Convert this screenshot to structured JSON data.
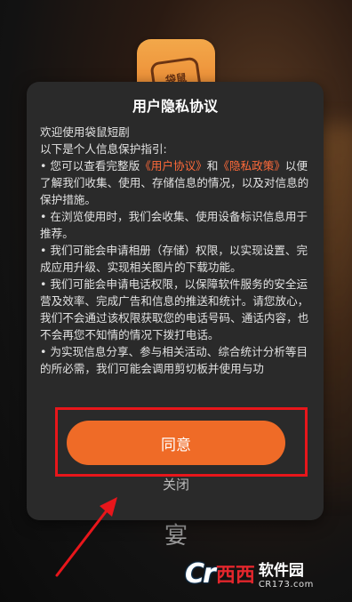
{
  "app_icon": {
    "label": "袋鼠"
  },
  "background_text": "宴",
  "dialog": {
    "title": "用户隐私协议",
    "intro1": "欢迎使用袋鼠短剧",
    "intro2": "以下是个人信息保护指引:",
    "b1_pre": "• 您可以查看完整版",
    "b1_link1": "《用户协议》",
    "b1_and": "和",
    "b1_link2": "《隐私政策》",
    "b1_post": "以便了解我们收集、使用、存储信息的情况，以及对信息的保护措施。",
    "b2": "• 在浏览使用时，我们会收集、使用设备标识信息用于推荐。",
    "b3": "• 我们可能会申请相册（存储）权限，以实现设置、完成应用升级、实现相关图片的下载功能。",
    "b4": "• 我们可能会申请电话权限，以保障软件服务的安全运营及效率、完成广告和信息的推送和统计。请您放心，我们不会通过该权限获取您的电话号码、通话内容，也不会再您不知情的情况下拨打电话。",
    "b5": "• 为实现信息分享、参与相关活动、综合统计分析等目的所必需，我们可能会调用剪切板并使用与功",
    "agree_label": "同意",
    "close_label": "关闭"
  },
  "watermark": {
    "logo": "Cr",
    "logo_cn": "西西",
    "name": "软件园",
    "url": "CR173.com"
  },
  "colors": {
    "accent": "#ef6b27",
    "link": "#ff6a3a",
    "highlight": "#e8161b"
  }
}
